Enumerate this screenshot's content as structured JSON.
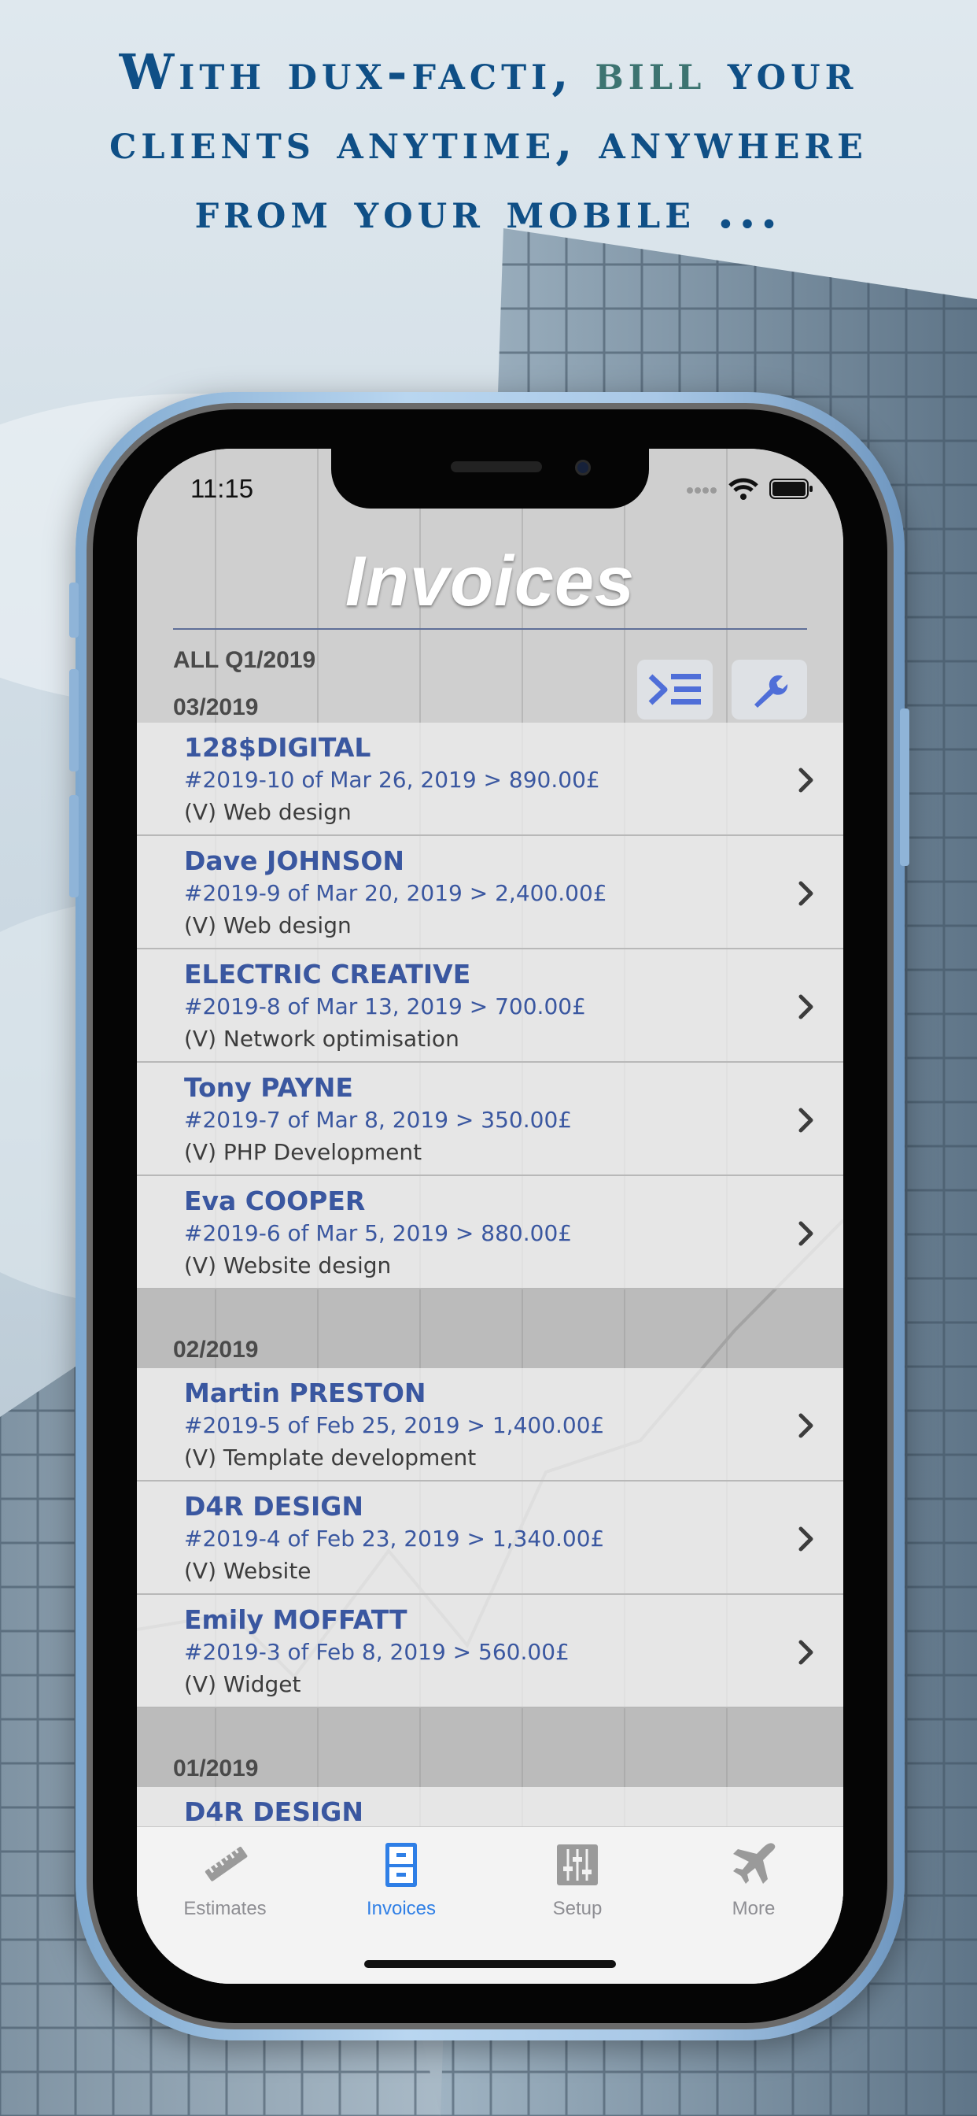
{
  "headline": {
    "part1": "With dux-facti, ",
    "accent": "bill",
    "part2": " your clients anytime, anywhere from your mobile ..."
  },
  "status_bar": {
    "time": "11:15"
  },
  "screen_title": "Invoices",
  "period_label": "ALL Q1/2019",
  "sections": [
    {
      "header": "03/2019",
      "rows": [
        {
          "name": "128$DIGITAL",
          "ref": "#2019-10 of Mar 26, 2019 > 890.00£",
          "desc": "(V) Web design"
        },
        {
          "name": "Dave JOHNSON",
          "ref": "#2019-9 of Mar 20, 2019 > 2,400.00£",
          "desc": "(V) Web design"
        },
        {
          "name": "ELECTRIC CREATIVE",
          "ref": "#2019-8 of Mar 13, 2019 > 700.00£",
          "desc": "(V) Network optimisation"
        },
        {
          "name": "Tony PAYNE",
          "ref": "#2019-7 of Mar 8, 2019 > 350.00£",
          "desc": "(V) PHP Development"
        },
        {
          "name": "Eva COOPER",
          "ref": "#2019-6 of Mar 5, 2019 > 880.00£",
          "desc": "(V) Website design"
        }
      ]
    },
    {
      "header": "02/2019",
      "rows": [
        {
          "name": "Martin PRESTON",
          "ref": "#2019-5 of Feb 25, 2019 > 1,400.00£",
          "desc": "(V) Template development"
        },
        {
          "name": "D4R DESIGN",
          "ref": "#2019-4 of Feb 23, 2019 > 1,340.00£",
          "desc": "(V) Website"
        },
        {
          "name": "Emily MOFFATT",
          "ref": "#2019-3 of Feb 8, 2019 > 560.00£",
          "desc": "(V) Widget"
        }
      ]
    },
    {
      "header": "01/2019",
      "rows": [
        {
          "name": "D4R DESIGN",
          "ref": "",
          "desc": ""
        }
      ]
    }
  ],
  "tabs": [
    {
      "label": "Estimates",
      "icon": "ruler-icon",
      "active": false
    },
    {
      "label": "Invoices",
      "icon": "cabinet-icon",
      "active": true
    },
    {
      "label": "Setup",
      "icon": "sliders-icon",
      "active": false
    },
    {
      "label": "More",
      "icon": "airplane-icon",
      "active": false
    }
  ],
  "colors": {
    "headline": "#0f4f86",
    "headline_accent": "#3d7471",
    "row_text": "#3a57a0",
    "tab_active": "#2f7fe6",
    "tab_inactive": "#8e8e93"
  }
}
